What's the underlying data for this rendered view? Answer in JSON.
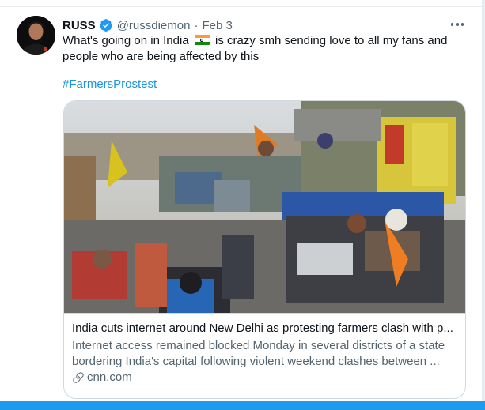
{
  "tweet": {
    "author": {
      "display_name": "RUSS",
      "handle": "@russdiemon",
      "verified": true
    },
    "separator": "·",
    "date": "Feb 3",
    "text_part1": "What's going on in India",
    "text_flag_icon": "india-flag-emoji",
    "text_part2": "is crazy smh sending love to all my fans and people who are being affected by this",
    "hashtag": "#FarmersProstest",
    "more_icon": "three-dots-horizontal"
  },
  "card": {
    "image_description_icon": "news-photo",
    "title": "India cuts internet around New Delhi as protesting farmers clash with p...",
    "description": "Internet access remained blocked Monday in several districts of a state bordering India's capital following violent weekend clashes between ...",
    "domain_icon": "link-icon",
    "domain": "cnn.com"
  },
  "colors": {
    "link_blue": "#1b95e0",
    "secondary_text": "#536471",
    "border": "#cfd9de",
    "bottom_bar": "#1d9bf0"
  }
}
